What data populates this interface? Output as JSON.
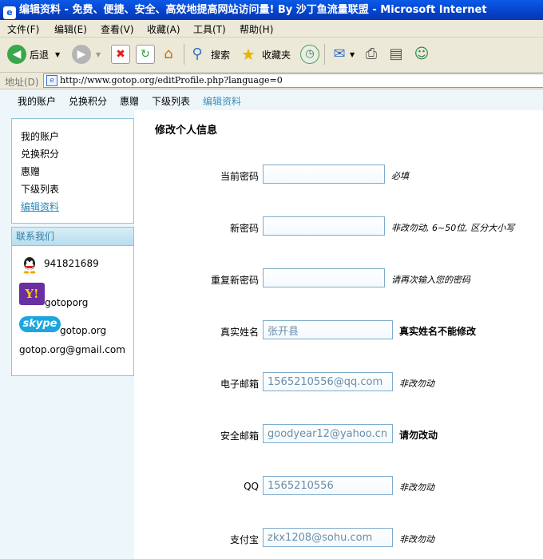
{
  "window": {
    "title": "编辑资料 - 免费、便捷、安全、高效地提高网站访问量! By 沙丁鱼流量联盟 - Microsoft Internet"
  },
  "menu": {
    "items": [
      "文件(F)",
      "编辑(E)",
      "查看(V)",
      "收藏(A)",
      "工具(T)",
      "帮助(H)"
    ]
  },
  "toolbar": {
    "back_label": "后退",
    "search_label": "搜索",
    "favorites_label": "收藏夹",
    "icons": [
      "back-icon",
      "forward-icon",
      "stop-icon",
      "refresh-icon",
      "home-icon",
      "search-icon",
      "favorites-icon",
      "history-icon",
      "mail-icon",
      "print-icon",
      "edit-icon",
      "messenger-icon"
    ]
  },
  "address": {
    "label": "地址(D)",
    "url": "http://www.gotop.org/editProfile.php?language=0"
  },
  "topnav": {
    "items": [
      "我的账户",
      "兑换积分",
      "惠赠",
      "下级列表",
      "编辑资料"
    ],
    "active_index": 4
  },
  "sidebar": {
    "nav_items": [
      "我的账户",
      "兑换积分",
      "惠赠",
      "下级列表",
      "编辑资料"
    ],
    "contact_title": "联系我们",
    "qq": "941821689",
    "yahoo": "gotoporg",
    "skype_logo": "skype",
    "skype": "gotop.org",
    "email": "gotop.org@gmail.com"
  },
  "form": {
    "title": "修改个人信息",
    "fields": [
      {
        "label": "当前密码",
        "value": "",
        "hint": "必填",
        "hint_bold": false
      },
      {
        "label": "新密码",
        "value": "",
        "hint": "非改勿动, 6~50位, 区分大小写",
        "hint_bold": false
      },
      {
        "label": "重复新密码",
        "value": "",
        "hint": "请再次输入您的密码",
        "hint_bold": false
      },
      {
        "label": "真实姓名",
        "value": "张开县",
        "hint": "真实姓名不能修改",
        "hint_bold": true
      },
      {
        "label": "电子邮箱",
        "value": "1565210556@qq.com",
        "hint": "非改勿动",
        "hint_bold": false
      },
      {
        "label": "安全邮箱",
        "value": "goodyear12@yahoo.cn",
        "hint": "请勿改动",
        "hint_bold": true
      },
      {
        "label": "QQ",
        "value": "1565210556",
        "hint": "非改勿动",
        "hint_bold": false
      },
      {
        "label": "支付宝",
        "value": "zkx1208@sohu.com",
        "hint": "非改勿动",
        "hint_bold": false
      }
    ]
  }
}
